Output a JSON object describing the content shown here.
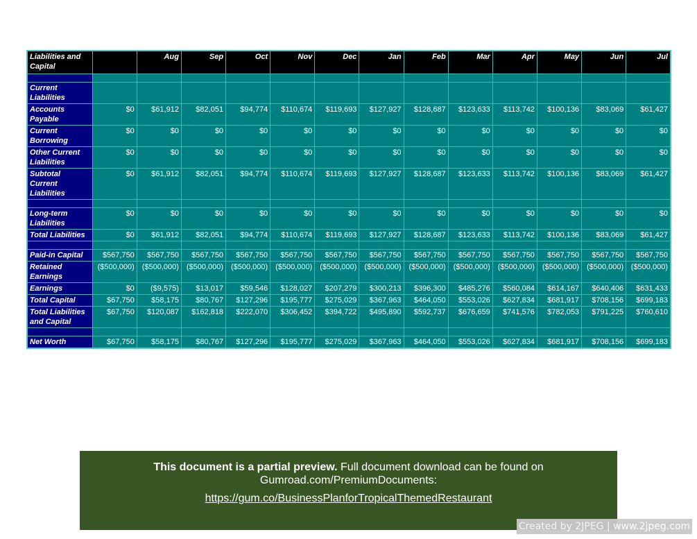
{
  "table": {
    "header_label": "Liabilities and Capital",
    "months": [
      "Aug",
      "Sep",
      "Oct",
      "Nov",
      "Dec",
      "Jan",
      "Feb",
      "Mar",
      "Apr",
      "May",
      "Jun",
      "Jul"
    ],
    "rows": [
      {
        "label": "",
        "spacer": true,
        "values": []
      },
      {
        "label": "Current Liabilities",
        "lines": 2,
        "values": []
      },
      {
        "label": "Accounts Payable",
        "lines": 2,
        "values": [
          "$0",
          "$61,912",
          "$82,051",
          "$94,774",
          "$110,674",
          "$119,693",
          "$127,927",
          "$128,687",
          "$123,633",
          "$113,742",
          "$100,136",
          "$83,069",
          "$61,427"
        ]
      },
      {
        "label": "Current Borrowing",
        "lines": 2,
        "values": [
          "$0",
          "$0",
          "$0",
          "$0",
          "$0",
          "$0",
          "$0",
          "$0",
          "$0",
          "$0",
          "$0",
          "$0",
          "$0"
        ]
      },
      {
        "label": "Other Current Liabilities",
        "lines": 2,
        "values": [
          "$0",
          "$0",
          "$0",
          "$0",
          "$0",
          "$0",
          "$0",
          "$0",
          "$0",
          "$0",
          "$0",
          "$0",
          "$0"
        ]
      },
      {
        "label": "Subtotal Current Liabilities",
        "lines": 3,
        "values": [
          "$0",
          "$61,912",
          "$82,051",
          "$94,774",
          "$110,674",
          "$119,693",
          "$127,927",
          "$128,687",
          "$123,633",
          "$113,742",
          "$100,136",
          "$83,069",
          "$61,427"
        ]
      },
      {
        "label": "",
        "spacer": true,
        "values": []
      },
      {
        "label": "Long-term Liabilities",
        "lines": 2,
        "values": [
          "$0",
          "$0",
          "$0",
          "$0",
          "$0",
          "$0",
          "$0",
          "$0",
          "$0",
          "$0",
          "$0",
          "$0",
          "$0"
        ]
      },
      {
        "label": "Total Liabilities",
        "lines": 1,
        "values": [
          "$0",
          "$61,912",
          "$82,051",
          "$94,774",
          "$110,674",
          "$119,693",
          "$127,927",
          "$128,687",
          "$123,633",
          "$113,742",
          "$100,136",
          "$83,069",
          "$61,427"
        ]
      },
      {
        "label": "",
        "spacer": true,
        "values": []
      },
      {
        "label": "Paid-in Capital",
        "lines": 1,
        "values": [
          "$567,750",
          "$567,750",
          "$567,750",
          "$567,750",
          "$567,750",
          "$567,750",
          "$567,750",
          "$567,750",
          "$567,750",
          "$567,750",
          "$567,750",
          "$567,750",
          "$567,750"
        ]
      },
      {
        "label": "Retained Earnings",
        "lines": 2,
        "values": [
          "($500,000)",
          "($500,000)",
          "($500,000)",
          "($500,000)",
          "($500,000)",
          "($500,000)",
          "($500,000)",
          "($500,000)",
          "($500,000)",
          "($500,000)",
          "($500,000)",
          "($500,000)",
          "($500,000)"
        ]
      },
      {
        "label": "Earnings",
        "lines": 1,
        "values": [
          "$0",
          "($9,575)",
          "$13,017",
          "$59,546",
          "$128,027",
          "$207,279",
          "$300,213",
          "$396,300",
          "$485,276",
          "$560,084",
          "$614,167",
          "$640,406",
          "$631,433"
        ]
      },
      {
        "label": "Total Capital",
        "lines": 1,
        "values": [
          "$67,750",
          "$58,175",
          "$80,767",
          "$127,296",
          "$195,777",
          "$275,029",
          "$367,963",
          "$464,050",
          "$553,026",
          "$627,834",
          "$681,917",
          "$708,156",
          "$699,183"
        ]
      },
      {
        "label": "Total Liabilities and Capital",
        "lines": 2,
        "values": [
          "$67,750",
          "$120,087",
          "$162,818",
          "$222,070",
          "$306,452",
          "$394,722",
          "$495,890",
          "$592,737",
          "$676,659",
          "$741,576",
          "$782,053",
          "$791,225",
          "$760,610"
        ]
      },
      {
        "label": "",
        "spacer": true,
        "values": []
      },
      {
        "label": "Net Worth",
        "lines": 1,
        "values": [
          "$67,750",
          "$58,175",
          "$80,767",
          "$127,296",
          "$195,777",
          "$275,029",
          "$367,963",
          "$464,050",
          "$553,026",
          "$627,834",
          "$681,917",
          "$708,156",
          "$699,183"
        ]
      }
    ]
  },
  "banner": {
    "bold_text": "This document is a partial preview.",
    "text": " Full document download can be found on Gumroad.com/PremiumDocuments:",
    "link": "https://gum.co/BusinessPlanforTropicalThemedRestaurant"
  },
  "watermark": "Created by 2JPEG | www.2jpeg.com",
  "colors": {
    "header_bg": "#000000",
    "label_bg": "#000080",
    "cell_bg": "#008080",
    "grid": "#3cb8b8",
    "banner_bg": "#375623"
  }
}
